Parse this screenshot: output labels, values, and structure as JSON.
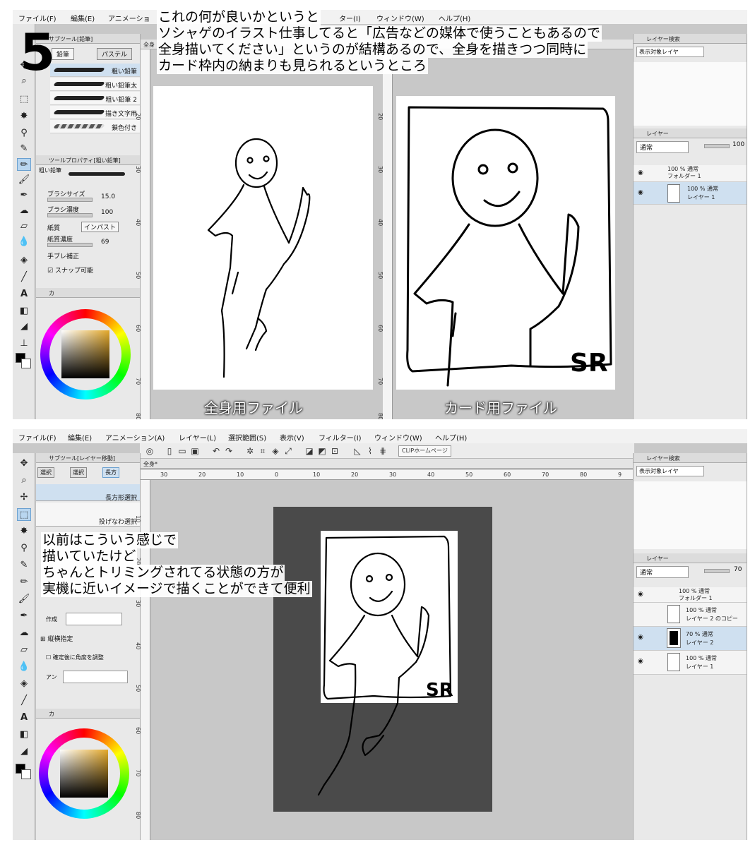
{
  "menu": [
    "ファイル(F)",
    "編集(E)",
    "アニメーション(A)",
    "レイヤー(L)",
    "選択範囲(S)",
    "表示(V)",
    "フィルター(I)",
    "ウィンドウ(W)",
    "ヘルプ(H)"
  ],
  "menu_top_visible": [
    "ファイル(F)",
    "編集(E)",
    "アニメーショ",
    "ター(I)",
    "ウィンドウ(W)",
    "ヘルプ(H)"
  ],
  "step_number": "5",
  "top": {
    "annotation": [
      "これの何が良いかというと",
      "ソシャゲのイラスト仕事してると「広告などの媒体で使うこともあるので",
      "全身描いてください」というのが結構あるので、全身を描きつつ同時に",
      "カード枠内の納まりも見られるというところ"
    ],
    "subtool_header": "サブツール[鉛筆]",
    "subtool_tabs": [
      "鉛筆",
      "パステル"
    ],
    "brushes": [
      "粗い鉛筆",
      "粗い鉛筆太",
      "粗い鉛筆 2",
      "描き文字用",
      "鎖色付き"
    ],
    "prop_header": "ツールプロパティ[粗い鉛筆]",
    "prop_brush": "粗い鉛筆",
    "brush_size_label": "ブラシサイズ",
    "brush_size_value": "15.0",
    "brush_density_label": "ブラシ濃度",
    "brush_density_value": "100",
    "paper_label": "紙質",
    "paper_button": "インパスト",
    "paper_density_label": "紙質濃度",
    "paper_density_value": "69",
    "stabilization_label": "手ブレ補正",
    "snap_label": "スナップ可能",
    "color_tab": "カ",
    "file_tab": "全身",
    "caption_left": "全身用ファイル",
    "caption_right": "カード用ファイル",
    "signature": "SR",
    "layer_search_tab": "レイヤー検索",
    "layer_search_placeholder": "表示対象レイヤ",
    "layer_tab": "レイヤー",
    "blend_mode": "通常",
    "opacity": "100",
    "layers": [
      {
        "line1": "100 % 通常",
        "line2": "フォルダー 1"
      },
      {
        "line1": "100 % 通常",
        "line2": "レイヤー 1"
      }
    ],
    "ruler_v": [
      "20",
      "30",
      "40",
      "50",
      "60",
      "70",
      "80"
    ]
  },
  "bottom": {
    "annotation": [
      "以前はこういう感じで",
      "描いていたけど",
      "ちゃんとトリミングされてる状態の方が",
      "実機に近いイメージで描くことができて便利"
    ],
    "subtool_header": "サブツール[レイヤー移動]",
    "subtool_tabs": [
      "選択",
      "選択",
      "長方"
    ],
    "items": [
      "長方形選択",
      "投げなわ選択"
    ],
    "create_label": "作成",
    "aspect_label": "縦横指定",
    "adjust_label": "確定後に角度を調整",
    "aa_label": "アン",
    "color_tab": "カ",
    "file_tab": "全身*",
    "home_button": "CLIPホームページ",
    "signature": "SR",
    "layer_search_tab": "レイヤー検索",
    "layer_search_placeholder": "表示対象レイヤ",
    "layer_tab": "レイヤー",
    "blend_mode": "通常",
    "opacity": "70",
    "layers": [
      {
        "line1": "100 % 通常",
        "line2": "フォルダー 1"
      },
      {
        "line1": "100 % 通常",
        "line2": "レイヤー 2 のコピー"
      },
      {
        "line1": "70 % 通常",
        "line2": "レイヤー 2"
      },
      {
        "line1": "100 % 通常",
        "line2": "レイヤー 1"
      }
    ],
    "ruler_h": [
      "30",
      "20",
      "10",
      "0",
      "10",
      "20",
      "30",
      "40",
      "50",
      "60",
      "70",
      "80",
      "9"
    ],
    "ruler_v": [
      "10",
      "20",
      "30",
      "40",
      "50",
      "60",
      "70",
      "80"
    ]
  },
  "colors": {
    "panel": "#e9e9e9",
    "canvas_bg": "#c8c8c8",
    "dark_page": "#4a4a4a",
    "selection": "#b9d6f0"
  }
}
